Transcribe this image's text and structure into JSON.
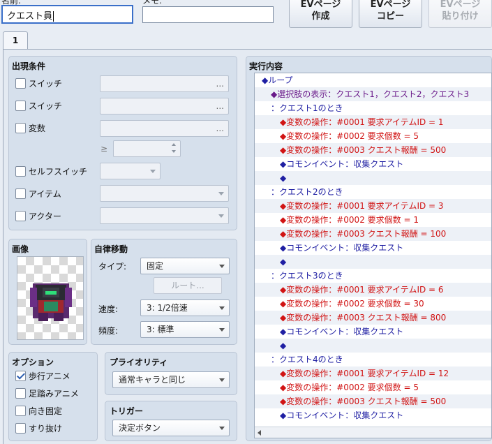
{
  "header": {
    "name_label": "名前:",
    "name_value": "クエスト員",
    "note_label": "メモ:",
    "note_value": "",
    "buttons": [
      {
        "line1": "EVページ",
        "line2": "作成",
        "enabled": true
      },
      {
        "line1": "EVページ",
        "line2": "コピー",
        "enabled": true
      },
      {
        "line1": "EVページ",
        "line2": "貼り付け",
        "enabled": false
      }
    ]
  },
  "tabs": [
    "1"
  ],
  "conditions": {
    "title": "出現条件",
    "switch1": {
      "label": "スイッチ",
      "value": "..."
    },
    "switch2": {
      "label": "スイッチ",
      "value": "..."
    },
    "variable": {
      "label": "変数",
      "value": "...",
      "ge": "≥"
    },
    "self_switch": {
      "label": "セルフスイッチ"
    },
    "item": {
      "label": "アイテム"
    },
    "actor": {
      "label": "アクター"
    }
  },
  "image": {
    "title": "画像"
  },
  "autonomous": {
    "title": "自律移動",
    "type_label": "タイプ:",
    "type_value": "固定",
    "route_button": "ルート...",
    "speed_label": "速度:",
    "speed_value": "3: 1/2倍速",
    "freq_label": "頻度:",
    "freq_value": "3: 標準"
  },
  "options": {
    "title": "オプション",
    "items": [
      {
        "label": "歩行アニメ",
        "checked": true
      },
      {
        "label": "足踏みアニメ",
        "checked": false
      },
      {
        "label": "向き固定",
        "checked": false
      },
      {
        "label": "すり抜け",
        "checked": false
      }
    ]
  },
  "priority": {
    "title": "プライオリティ",
    "value": "通常キャラと同じ"
  },
  "trigger": {
    "title": "トリガー",
    "value": "決定ボタン"
  },
  "contents": {
    "title": "実行内容",
    "lines": [
      {
        "indent": 0,
        "text": "◆ループ",
        "color": "blue"
      },
      {
        "indent": 1,
        "text": "◆選択肢の表示：クエスト1，クエスト2，クエスト3",
        "color": "purple"
      },
      {
        "indent": 1,
        "text": "：クエスト1のとき",
        "color": "blue"
      },
      {
        "indent": 2,
        "text": "◆変数の操作：#0001 要求アイテムID = 1",
        "color": "red"
      },
      {
        "indent": 2,
        "text": "◆変数の操作：#0002 要求個数 = 5",
        "color": "red"
      },
      {
        "indent": 2,
        "text": "◆変数の操作：#0003 クエスト報酬 = 500",
        "color": "red"
      },
      {
        "indent": 2,
        "text": "◆コモンイベント：収集クエスト",
        "color": "blue"
      },
      {
        "indent": 2,
        "text": "◆",
        "color": "dark"
      },
      {
        "indent": 1,
        "text": "：クエスト2のとき",
        "color": "blue"
      },
      {
        "indent": 2,
        "text": "◆変数の操作：#0001 要求アイテムID = 3",
        "color": "red"
      },
      {
        "indent": 2,
        "text": "◆変数の操作：#0002 要求個数 = 1",
        "color": "red"
      },
      {
        "indent": 2,
        "text": "◆変数の操作：#0003 クエスト報酬 = 100",
        "color": "red"
      },
      {
        "indent": 2,
        "text": "◆コモンイベント：収集クエスト",
        "color": "blue"
      },
      {
        "indent": 2,
        "text": "◆",
        "color": "dark"
      },
      {
        "indent": 1,
        "text": "：クエスト3のとき",
        "color": "blue"
      },
      {
        "indent": 2,
        "text": "◆変数の操作：#0001 要求アイテムID = 6",
        "color": "red"
      },
      {
        "indent": 2,
        "text": "◆変数の操作：#0002 要求個数 = 30",
        "color": "red"
      },
      {
        "indent": 2,
        "text": "◆変数の操作：#0003 クエスト報酬 = 800",
        "color": "red"
      },
      {
        "indent": 2,
        "text": "◆コモンイベント：収集クエスト",
        "color": "blue"
      },
      {
        "indent": 2,
        "text": "◆",
        "color": "dark"
      },
      {
        "indent": 1,
        "text": "：クエスト4のとき",
        "color": "blue"
      },
      {
        "indent": 2,
        "text": "◆変数の操作：#0001 要求アイテムID = 12",
        "color": "red"
      },
      {
        "indent": 2,
        "text": "◆変数の操作：#0002 要求個数 = 5",
        "color": "red"
      },
      {
        "indent": 2,
        "text": "◆変数の操作：#0003 クエスト報酬 = 500",
        "color": "red"
      },
      {
        "indent": 2,
        "text": "◆コモンイベント：収集クエスト",
        "color": "blue"
      }
    ]
  }
}
